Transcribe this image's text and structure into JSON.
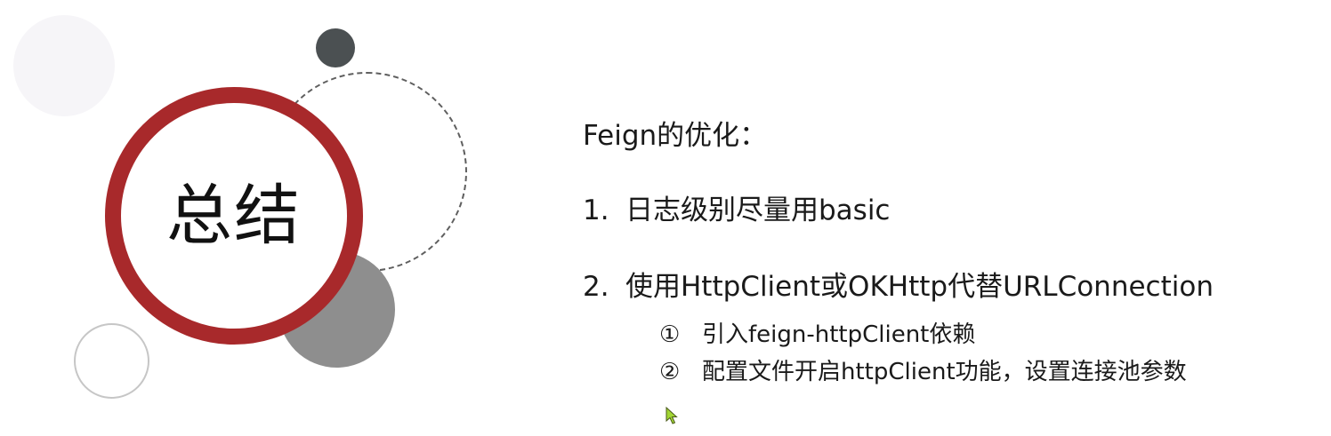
{
  "title": "总结",
  "heading": "Feign的优化：",
  "items": [
    {
      "number": "1.",
      "text": "日志级别尽量用basic"
    },
    {
      "number": "2.",
      "text": "使用HttpClient或OKHttp代替URLConnection"
    }
  ],
  "subitems": [
    {
      "marker": "①",
      "text": "引入feign-httpClient依赖"
    },
    {
      "marker": "②",
      "text": "配置文件开启httpClient功能，设置连接池参数"
    }
  ],
  "colors": {
    "accent_red": "#a8292b",
    "dark_gray": "#4b5052",
    "mid_gray": "#8e8e8e",
    "cursor": "#a2d634"
  },
  "icons": {
    "cursor": "mouse-pointer-icon"
  }
}
